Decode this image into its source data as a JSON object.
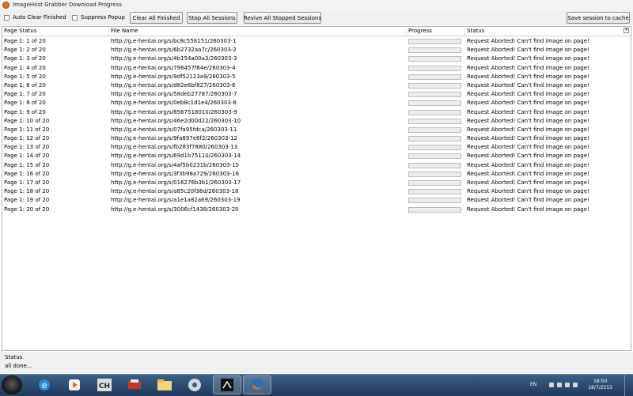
{
  "window": {
    "title": "ImageHost Grabber Download Progress"
  },
  "toolbar": {
    "auto_clear_label": "Auto Clear Finished",
    "suppress_popup_label": "Suppress Popup",
    "clear_all_label": "Clear All Finished",
    "stop_all_label": "Stop All Sessions",
    "revive_label": "Revive All Stopped Sessions",
    "save_cache_label": "Save session to cache"
  },
  "table": {
    "columns": [
      "Page Status",
      "File Name",
      "Progress",
      "Status"
    ],
    "rows": [
      {
        "page": "Page 1: 1 of 20",
        "file": "http://g.e-hentai.org/s/bc8c558151/260303-1",
        "progress": 0,
        "status": "Request Aborted!  Can't find image on page!"
      },
      {
        "page": "Page 1: 2 of 20",
        "file": "http://g.e-hentai.org/s/6b2732aa7c/260303-2",
        "progress": 0,
        "status": "Request Aborted!  Can't find image on page!"
      },
      {
        "page": "Page 1: 3 of 20",
        "file": "http://g.e-hentai.org/s/4b154a00a3/260303-3",
        "progress": 0,
        "status": "Request Aborted!  Can't find image on page!"
      },
      {
        "page": "Page 1: 4 of 20",
        "file": "http://g.e-hentai.org/s/796457f64e/260303-4",
        "progress": 0,
        "status": "Request Aborted!  Can't find image on page!"
      },
      {
        "page": "Page 1: 5 of 20",
        "file": "http://g.e-hentai.org/s/9df52123a9/260303-5",
        "progress": 0,
        "status": "Request Aborted!  Can't find image on page!"
      },
      {
        "page": "Page 1: 6 of 20",
        "file": "http://g.e-hentai.org/s/d82e6bf827/260303-6",
        "progress": 0,
        "status": "Request Aborted!  Can't find image on page!"
      },
      {
        "page": "Page 1: 7 of 20",
        "file": "http://g.e-hentai.org/s/58deb27787/260303-7",
        "progress": 0,
        "status": "Request Aborted!  Can't find image on page!"
      },
      {
        "page": "Page 1: 8 of 20",
        "file": "http://g.e-hentai.org/s/0eb8c1d1e4/260303-8",
        "progress": 0,
        "status": "Request Aborted!  Can't find image on page!"
      },
      {
        "page": "Page 1: 9 of 20",
        "file": "http://g.e-hentai.org/s/8567518010/260303-9",
        "progress": 0,
        "status": "Request Aborted!  Can't find image on page!"
      },
      {
        "page": "Page 1: 10 of 20",
        "file": "http://g.e-hentai.org/s/46e2d00d22/260303-10",
        "progress": 0,
        "status": "Request Aborted!  Can't find image on page!"
      },
      {
        "page": "Page 1: 11 of 20",
        "file": "http://g.e-hentai.org/s/07fa95fdca/260303-11",
        "progress": 0,
        "status": "Request Aborted!  Can't find image on page!"
      },
      {
        "page": "Page 1: 12 of 20",
        "file": "http://g.e-hentai.org/s/9fa897e6f2/260303-12",
        "progress": 0,
        "status": "Request Aborted!  Can't find image on page!"
      },
      {
        "page": "Page 1: 13 of 20",
        "file": "http://g.e-hentai.org/s/fb283f7880/260303-13",
        "progress": 0,
        "status": "Request Aborted!  Can't find image on page!"
      },
      {
        "page": "Page 1: 14 of 20",
        "file": "http://g.e-hentai.org/s/69d1b75110/260303-14",
        "progress": 0,
        "status": "Request Aborted!  Can't find image on page!"
      },
      {
        "page": "Page 1: 15 of 20",
        "file": "http://g.e-hentai.org/s/4af5b0231b/260303-15",
        "progress": 0,
        "status": "Request Aborted!  Can't find image on page!"
      },
      {
        "page": "Page 1: 16 of 20",
        "file": "http://g.e-hentai.org/s/3f3b98a729/260303-16",
        "progress": 0,
        "status": "Request Aborted!  Can't find image on page!"
      },
      {
        "page": "Page 1: 17 of 20",
        "file": "http://g.e-hentai.org/s/016276b3b1/260303-17",
        "progress": 0,
        "status": "Request Aborted!  Can't find image on page!"
      },
      {
        "page": "Page 1: 18 of 20",
        "file": "http://g.e-hentai.org/s/a85c20f36d/260303-18",
        "progress": 0,
        "status": "Request Aborted!  Can't find image on page!"
      },
      {
        "page": "Page 1: 19 of 20",
        "file": "http://g.e-hentai.org/s/a1e1a82a69/260303-19",
        "progress": 0,
        "status": "Request Aborted!  Can't find image on page!"
      },
      {
        "page": "Page 1: 20 of 20",
        "file": "http://g.e-hentai.org/s/3006cf1438/260303-20",
        "progress": 0,
        "status": "Request Aborted!  Can't find image on page!"
      }
    ]
  },
  "status": {
    "label": "Status",
    "message": "all done..."
  },
  "taskbar": {
    "items": [
      "windows-start-orb",
      "internet-explorer-icon",
      "media-player-icon",
      "ch-app-icon",
      "car-app-icon",
      "file-explorer-icon",
      "daemon-tools-icon",
      "mouse-app-icon",
      "firefox-icon"
    ],
    "language": "EN",
    "time": "18:50",
    "date": "18/7/2553"
  },
  "colors": {
    "taskbar": "#2b4c73",
    "progress_fill": "#4cbb4c",
    "firefox_orange": "#e07020"
  }
}
